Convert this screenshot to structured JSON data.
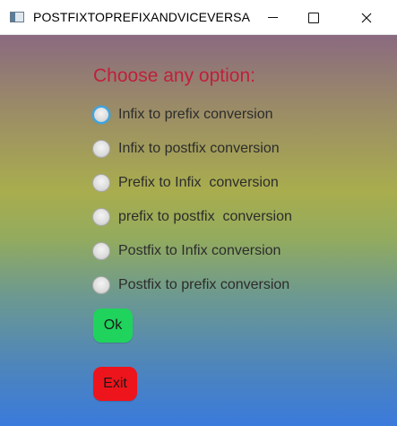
{
  "window": {
    "title": "POSTFIXTOPREFIXANDVICEVERSA",
    "controls": {
      "minimize_icon": "minimize-icon",
      "maximize_icon": "maximize-icon",
      "close_icon": "close-icon"
    }
  },
  "form": {
    "heading": "Choose any option:",
    "options": [
      {
        "label": "Infix to prefix conversion",
        "selected": false,
        "focused": true
      },
      {
        "label": "Infix to postfix conversion",
        "selected": false,
        "focused": false
      },
      {
        "label": "Prefix to Infix  conversion",
        "selected": false,
        "focused": false
      },
      {
        "label": "prefix to postfix  conversion",
        "selected": false,
        "focused": false
      },
      {
        "label": "Postfix to Infix conversion",
        "selected": false,
        "focused": false
      },
      {
        "label": "Postfix to prefix conversion",
        "selected": false,
        "focused": false
      }
    ],
    "ok_label": "Ok",
    "exit_label": "Exit"
  },
  "colors": {
    "heading": "#c0203a",
    "ok_button": "#1fd35c",
    "exit_button": "#ee141c",
    "focus_ring": "#3aa6e6"
  }
}
